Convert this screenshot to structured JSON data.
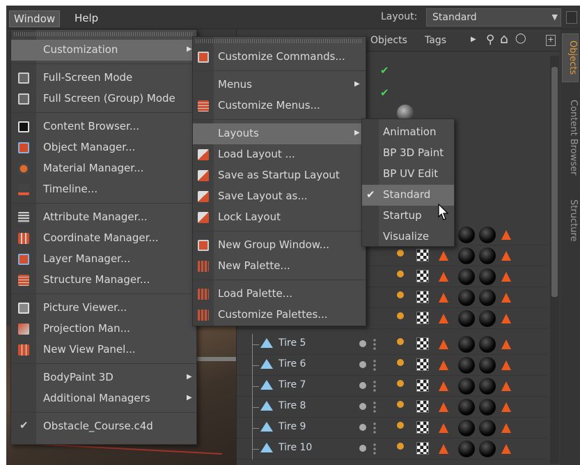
{
  "menubar": {
    "items": [
      {
        "label": "Window"
      },
      {
        "label": "Help"
      }
    ],
    "layout_label": "Layout:",
    "layout_value": "Standard"
  },
  "objects_panel": {
    "header": {
      "objects": "Objects",
      "tags": "Tags"
    },
    "rows": [
      {
        "label": "Tire 5"
      },
      {
        "label": "Tire 6"
      },
      {
        "label": "Tire 7"
      },
      {
        "label": "Tire 8"
      },
      {
        "label": "Tire 9"
      },
      {
        "label": "Tire 10"
      }
    ]
  },
  "side_tabs": {
    "objects": "Objects",
    "content_browser": "Content Browser",
    "structure": "Structure"
  },
  "window_menu": {
    "items": [
      {
        "label": "Customization",
        "icon": "none",
        "submenu": true
      },
      {
        "label": "Full-Screen Mode",
        "icon": "fullscreen-icon"
      },
      {
        "label": "Full Screen (Group) Mode",
        "icon": "fullscreen-group-icon"
      },
      {
        "label": "Content Browser...",
        "icon": "content-browser-icon"
      },
      {
        "label": "Object Manager...",
        "icon": "object-manager-icon"
      },
      {
        "label": "Material Manager...",
        "icon": "material-manager-icon"
      },
      {
        "label": "Timeline...",
        "icon": "timeline-icon"
      },
      {
        "label": "Attribute Manager...",
        "icon": "attribute-manager-icon"
      },
      {
        "label": "Coordinate Manager...",
        "icon": "coordinate-manager-icon"
      },
      {
        "label": "Layer Manager...",
        "icon": "layer-manager-icon"
      },
      {
        "label": "Structure Manager...",
        "icon": "structure-manager-icon"
      },
      {
        "label": "Picture Viewer...",
        "icon": "picture-viewer-icon"
      },
      {
        "label": "Projection Man...",
        "icon": "projection-manager-icon"
      },
      {
        "label": "New View Panel...",
        "icon": "view-panel-icon"
      },
      {
        "label": "BodyPaint 3D",
        "submenu": true
      },
      {
        "label": "Additional Managers",
        "submenu": true
      },
      {
        "label": "Obstacle_Course.c4d",
        "checked": true
      }
    ]
  },
  "customization_menu": {
    "items": [
      {
        "label": "Customize Commands...",
        "icon": "customize-commands-icon"
      },
      {
        "label": "Menus",
        "submenu": true
      },
      {
        "label": "Customize Menus...",
        "icon": "customize-menus-icon"
      },
      {
        "label": "Layouts",
        "submenu": true
      },
      {
        "label": "Load Layout ...",
        "icon": "load-layout-icon"
      },
      {
        "label": "Save as Startup Layout",
        "icon": "save-startup-layout-icon"
      },
      {
        "label": "Save Layout as...",
        "icon": "save-layout-icon"
      },
      {
        "label": "Lock Layout",
        "icon": "lock-layout-icon"
      },
      {
        "label": "New Group Window...",
        "icon": "new-group-window-icon"
      },
      {
        "label": "New Palette...",
        "icon": "new-palette-icon"
      },
      {
        "label": "Load Palette...",
        "icon": "load-palette-icon"
      },
      {
        "label": "Customize Palettes...",
        "icon": "customize-palettes-icon"
      }
    ]
  },
  "layouts_menu": {
    "items": [
      {
        "label": "Animation"
      },
      {
        "label": "BP 3D Paint"
      },
      {
        "label": "BP UV Edit"
      },
      {
        "label": "Standard",
        "checked": true
      },
      {
        "label": "Startup"
      },
      {
        "label": "Visualize"
      }
    ]
  },
  "colors": {
    "menu_bg": "#4a4a4a",
    "highlight": "#6a6a6a",
    "accent_orange": "#ee5a1e",
    "check_green": "#4cd25a"
  }
}
